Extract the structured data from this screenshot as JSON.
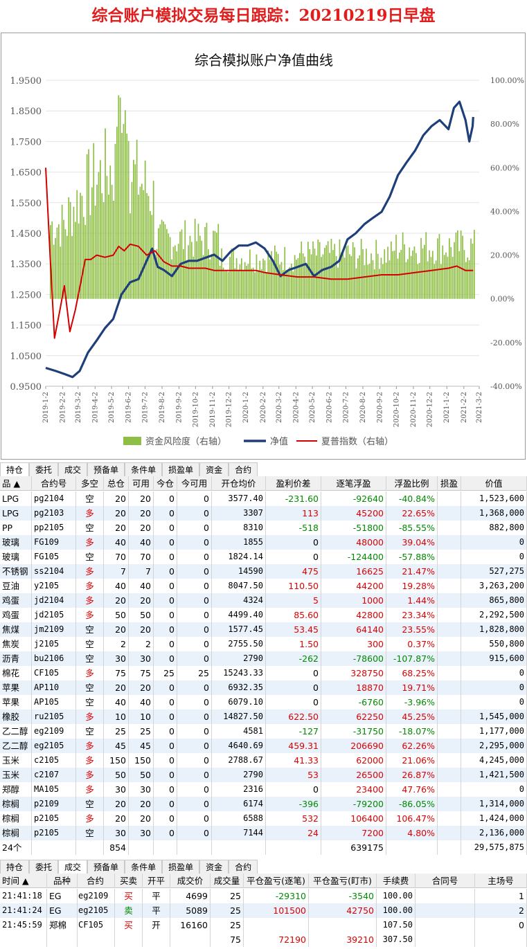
{
  "header": {
    "title": "综合账户模拟交易每日跟踪：20210219日早盘"
  },
  "chart_data": {
    "type": "line",
    "title": "综合模拟账户净值曲线",
    "y_left": {
      "ticks": [
        "1.9500",
        "1.8500",
        "1.7500",
        "1.6500",
        "1.5500",
        "1.4500",
        "1.3500",
        "1.2500",
        "1.1500",
        "1.0500",
        "0.9500"
      ],
      "ylim": [
        0.95,
        1.95
      ]
    },
    "y_right": {
      "ticks": [
        "100.00%",
        "80.00%",
        "60.00%",
        "40.00%",
        "20.00%",
        "0.00%",
        "-20.00%",
        "-40.00%"
      ],
      "ylim": [
        -40,
        100
      ]
    },
    "x_ticks": [
      "2019-1-2",
      "2019-2-2",
      "2019-3-2",
      "2019-4-2",
      "2019-5-2",
      "2019-6-2",
      "2019-7-2",
      "2019-8-2",
      "2019-9-2",
      "2019-10-2",
      "2019-11-2",
      "2019-12-2",
      "2020-1-2",
      "2020-2-2",
      "2020-3-2",
      "2020-4-2",
      "2020-5-2",
      "2020-6-2",
      "2020-7-2",
      "2020-8-2",
      "2020-9-2",
      "2020-10-2",
      "2020-11-2",
      "2020-12-2",
      "2021-1-2",
      "2021-2-2",
      "2021-3-2"
    ],
    "legend": [
      "资金风险度（右轴）",
      "净值",
      "夏普指数（右轴）"
    ],
    "colors": {
      "risk": "#8fbe45",
      "nav": "#1f3f7a",
      "sharpe": "#d40000"
    },
    "nav": [
      [
        "2019-1-2",
        1.01
      ],
      [
        "2019-1-20",
        1.0
      ],
      [
        "2019-2-5",
        0.99
      ],
      [
        "2019-2-20",
        0.98
      ],
      [
        "2019-3-5",
        1.0
      ],
      [
        "2019-3-20",
        1.06
      ],
      [
        "2019-4-5",
        1.1
      ],
      [
        "2019-4-20",
        1.14
      ],
      [
        "2019-5-5",
        1.17
      ],
      [
        "2019-5-20",
        1.25
      ],
      [
        "2019-6-5",
        1.29
      ],
      [
        "2019-6-20",
        1.3
      ],
      [
        "2019-7-5",
        1.36
      ],
      [
        "2019-7-15",
        1.4
      ],
      [
        "2019-7-25",
        1.34
      ],
      [
        "2019-8-5",
        1.33
      ],
      [
        "2019-8-20",
        1.31
      ],
      [
        "2019-9-5",
        1.35
      ],
      [
        "2019-9-20",
        1.36
      ],
      [
        "2019-10-5",
        1.36
      ],
      [
        "2019-10-20",
        1.37
      ],
      [
        "2019-11-5",
        1.38
      ],
      [
        "2019-11-20",
        1.36
      ],
      [
        "2019-12-5",
        1.39
      ],
      [
        "2019-12-20",
        1.41
      ],
      [
        "2020-1-5",
        1.41
      ],
      [
        "2020-1-20",
        1.42
      ],
      [
        "2020-2-5",
        1.4
      ],
      [
        "2020-2-20",
        1.36
      ],
      [
        "2020-3-5",
        1.31
      ],
      [
        "2020-3-20",
        1.33
      ],
      [
        "2020-4-5",
        1.34
      ],
      [
        "2020-4-20",
        1.35
      ],
      [
        "2020-5-5",
        1.31
      ],
      [
        "2020-5-20",
        1.33
      ],
      [
        "2020-6-5",
        1.34
      ],
      [
        "2020-6-20",
        1.36
      ],
      [
        "2020-7-5",
        1.43
      ],
      [
        "2020-7-20",
        1.45
      ],
      [
        "2020-8-5",
        1.48
      ],
      [
        "2020-8-20",
        1.5
      ],
      [
        "2020-9-5",
        1.52
      ],
      [
        "2020-9-20",
        1.57
      ],
      [
        "2020-10-5",
        1.64
      ],
      [
        "2020-10-20",
        1.68
      ],
      [
        "2020-11-5",
        1.72
      ],
      [
        "2020-11-20",
        1.77
      ],
      [
        "2020-12-5",
        1.8
      ],
      [
        "2020-12-20",
        1.82
      ],
      [
        "2021-1-5",
        1.79
      ],
      [
        "2021-1-15",
        1.86
      ],
      [
        "2021-1-25",
        1.88
      ],
      [
        "2021-2-5",
        1.82
      ],
      [
        "2021-2-12",
        1.75
      ],
      [
        "2021-2-18",
        1.8
      ],
      [
        "2021-2-19",
        1.83
      ]
    ],
    "sharpe": [
      [
        "2019-1-2",
        60
      ],
      [
        "2019-1-10",
        20
      ],
      [
        "2019-1-18",
        -18
      ],
      [
        "2019-1-28",
        -5
      ],
      [
        "2019-2-5",
        6
      ],
      [
        "2019-2-15",
        -15
      ],
      [
        "2019-2-25",
        -5
      ],
      [
        "2019-3-5",
        5
      ],
      [
        "2019-3-15",
        18
      ],
      [
        "2019-3-25",
        18
      ],
      [
        "2019-4-5",
        20
      ],
      [
        "2019-4-20",
        19
      ],
      [
        "2019-5-5",
        20
      ],
      [
        "2019-5-15",
        24
      ],
      [
        "2019-5-25",
        22
      ],
      [
        "2019-6-5",
        25
      ],
      [
        "2019-6-20",
        24
      ],
      [
        "2019-7-5",
        20
      ],
      [
        "2019-7-20",
        22
      ],
      [
        "2019-8-5",
        17
      ],
      [
        "2019-8-20",
        15
      ],
      [
        "2019-9-5",
        15
      ],
      [
        "2019-9-20",
        14
      ],
      [
        "2019-10-5",
        14
      ],
      [
        "2019-10-20",
        14
      ],
      [
        "2019-11-5",
        13
      ],
      [
        "2019-11-20",
        13
      ],
      [
        "2019-12-5",
        13
      ],
      [
        "2019-12-20",
        13
      ],
      [
        "2020-1-5",
        13
      ],
      [
        "2020-1-20",
        13
      ],
      [
        "2020-2-5",
        12
      ],
      [
        "2020-3-5",
        11
      ],
      [
        "2020-4-5",
        10
      ],
      [
        "2020-5-5",
        10
      ],
      [
        "2020-6-5",
        9
      ],
      [
        "2020-7-5",
        9
      ],
      [
        "2020-8-5",
        10
      ],
      [
        "2020-9-5",
        11
      ],
      [
        "2020-10-5",
        11
      ],
      [
        "2020-11-5",
        12
      ],
      [
        "2020-12-5",
        13
      ],
      [
        "2021-1-5",
        14
      ],
      [
        "2021-1-20",
        15
      ],
      [
        "2021-2-5",
        13
      ],
      [
        "2021-2-19",
        13
      ]
    ]
  },
  "pos_tabs": [
    "持仓",
    "委托",
    "成交",
    "预备单",
    "条件单",
    "损盈单",
    "资金",
    "合约"
  ],
  "positions": {
    "headers": [
      "品 ▲",
      "合约号",
      "多空",
      "总仓",
      "可用",
      "今仓",
      "今可用",
      "开仓均价",
      "盈利价差",
      "逐笔浮盈",
      "浮盈比例",
      "损盈",
      "价值"
    ],
    "rows": [
      [
        "LPG",
        "pg2104",
        "空",
        "20",
        "20",
        "0",
        "0",
        "3577.40",
        "-231.60",
        "-92640",
        "-40.84%",
        "",
        "1,523,600"
      ],
      [
        "LPG",
        "pg2103",
        "多",
        "20",
        "20",
        "0",
        "0",
        "3307",
        "113",
        "45200",
        "22.65%",
        "",
        "1,368,000"
      ],
      [
        "PP",
        "pp2105",
        "空",
        "20",
        "20",
        "0",
        "0",
        "8310",
        "-518",
        "-51800",
        "-85.55%",
        "",
        "882,800"
      ],
      [
        "玻璃",
        "FG109",
        "多",
        "40",
        "40",
        "0",
        "0",
        "1855",
        "0",
        "48000",
        "39.04%",
        "",
        "0"
      ],
      [
        "玻璃",
        "FG105",
        "空",
        "70",
        "70",
        "0",
        "0",
        "1824.14",
        "0",
        "-124400",
        "-57.88%",
        "",
        "0"
      ],
      [
        "不锈钢",
        "ss2104",
        "多",
        "7",
        "7",
        "0",
        "0",
        "14590",
        "475",
        "16625",
        "21.47%",
        "",
        "527,275"
      ],
      [
        "豆油",
        "y2105",
        "多",
        "40",
        "40",
        "0",
        "0",
        "8047.50",
        "110.50",
        "44200",
        "19.28%",
        "",
        "3,263,200"
      ],
      [
        "鸡蛋",
        "jd2104",
        "多",
        "20",
        "20",
        "0",
        "0",
        "4324",
        "5",
        "1000",
        "1.44%",
        "",
        "865,800"
      ],
      [
        "鸡蛋",
        "jd2105",
        "多",
        "50",
        "50",
        "0",
        "0",
        "4499.40",
        "85.60",
        "42800",
        "23.34%",
        "",
        "2,292,500"
      ],
      [
        "焦煤",
        "jm2109",
        "空",
        "20",
        "20",
        "0",
        "0",
        "1577.45",
        "53.45",
        "64140",
        "23.55%",
        "",
        "1,828,800"
      ],
      [
        "焦炭",
        "j2105",
        "空",
        "2",
        "2",
        "0",
        "0",
        "2755.50",
        "1.50",
        "300",
        "0.37%",
        "",
        "550,800"
      ],
      [
        "沥青",
        "bu2106",
        "空",
        "30",
        "30",
        "0",
        "0",
        "2790",
        "-262",
        "-78600",
        "-107.87%",
        "",
        "915,600"
      ],
      [
        "棉花",
        "CF105",
        "多",
        "75",
        "75",
        "25",
        "25",
        "15243.33",
        "0",
        "328750",
        "68.25%",
        "",
        "0"
      ],
      [
        "苹果",
        "AP110",
        "空",
        "20",
        "20",
        "0",
        "0",
        "6932.35",
        "0",
        "18870",
        "19.71%",
        "",
        "0"
      ],
      [
        "苹果",
        "AP105",
        "空",
        "40",
        "40",
        "0",
        "0",
        "6079.10",
        "0",
        "-6760",
        "-3.96%",
        "",
        "0"
      ],
      [
        "橡胶",
        "ru2105",
        "多",
        "10",
        "10",
        "0",
        "0",
        "14827.50",
        "622.50",
        "62250",
        "45.25%",
        "",
        "1,545,000"
      ],
      [
        "乙二醇",
        "eg2109",
        "空",
        "25",
        "25",
        "0",
        "0",
        "4581",
        "-127",
        "-31750",
        "-18.07%",
        "",
        "1,177,000"
      ],
      [
        "乙二醇",
        "eg2105",
        "多",
        "45",
        "45",
        "0",
        "0",
        "4640.69",
        "459.31",
        "206690",
        "62.26%",
        "",
        "2,295,000"
      ],
      [
        "玉米",
        "c2105",
        "多",
        "150",
        "150",
        "0",
        "0",
        "2788.67",
        "41.33",
        "62000",
        "21.06%",
        "",
        "4,245,000"
      ],
      [
        "玉米",
        "c2107",
        "多",
        "50",
        "50",
        "0",
        "0",
        "2790",
        "53",
        "26500",
        "26.87%",
        "",
        "1,421,500"
      ],
      [
        "郑醇",
        "MA105",
        "多",
        "30",
        "30",
        "0",
        "0",
        "2316",
        "0",
        "23400",
        "47.76%",
        "",
        "0"
      ],
      [
        "棕榈",
        "p2109",
        "空",
        "20",
        "20",
        "0",
        "0",
        "6174",
        "-396",
        "-79200",
        "-86.05%",
        "",
        "1,314,000"
      ],
      [
        "棕榈",
        "p2105",
        "多",
        "20",
        "20",
        "0",
        "0",
        "6588",
        "532",
        "106400",
        "106.47%",
        "",
        "1,424,000"
      ],
      [
        "棕榈",
        "p2105",
        "空",
        "30",
        "30",
        "0",
        "0",
        "7144",
        "24",
        "7200",
        "4.80%",
        "",
        "2,136,000"
      ]
    ],
    "total": [
      "24个",
      "",
      "",
      "854",
      "",
      "",
      "",
      "",
      "",
      "639175",
      "",
      "",
      "29,575,875"
    ]
  },
  "trade_tabs": [
    "持仓",
    "委托",
    "成交",
    "预备单",
    "条件单",
    "损盈单",
    "资金",
    "合约"
  ],
  "trades": {
    "headers": [
      "时间 ▲",
      "品种",
      "合约",
      "买卖",
      "开平",
      "成交价",
      "成交量",
      "平仓盈亏(逐笔)",
      "平仓盈亏(盯市)",
      "手续费",
      "合同号",
      "主场号"
    ],
    "rows": [
      [
        "21:41:18",
        "EG",
        "eg2109",
        "买",
        "平",
        "4699",
        "25",
        "-29310",
        "-3540",
        "100.00",
        "",
        "1"
      ],
      [
        "21:41:24",
        "EG",
        "eg2105",
        "卖",
        "平",
        "5089",
        "25",
        "101500",
        "42750",
        "100.00",
        "",
        "2"
      ],
      [
        "21:45:59",
        "郑棉",
        "CF105",
        "买",
        "开",
        "16160",
        "25",
        "",
        "",
        "107.50",
        "",
        "0"
      ]
    ],
    "total": [
      "",
      "",
      "",
      "",
      "",
      "",
      "75",
      "72190",
      "39210",
      "307.50",
      "",
      ""
    ]
  }
}
